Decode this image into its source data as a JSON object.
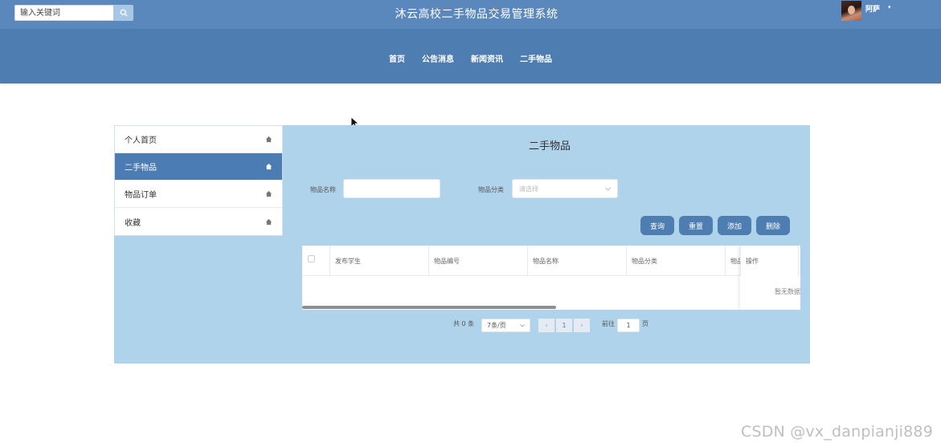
{
  "header": {
    "search_placeholder": "输入关键词",
    "site_title": "沐云高校二手物品交易管理系统",
    "username": "阿萨",
    "caret": "▾"
  },
  "nav": {
    "items": [
      "首页",
      "公告消息",
      "新闻资讯",
      "二手物品"
    ]
  },
  "sidebar": {
    "items": [
      {
        "label": "个人首页",
        "active": false
      },
      {
        "label": "二手物品",
        "active": true
      },
      {
        "label": "物品订单",
        "active": false
      },
      {
        "label": "收藏",
        "active": false
      }
    ]
  },
  "main": {
    "title": "二手物品",
    "filters": {
      "name_label": "物品名称",
      "name_value": "",
      "category_label": "物品分类",
      "category_placeholder": "请选择"
    },
    "buttons": {
      "query": "查询",
      "reset": "重置",
      "add": "添加",
      "delete": "删除"
    },
    "table": {
      "columns": [
        "发布学生",
        "物品编号",
        "物品名称",
        "物品分类",
        "物品"
      ],
      "fixed_column": "操作",
      "empty_text": "暂无数据"
    },
    "pagination": {
      "total": "共 0 条",
      "page_size": "7条/页",
      "current_page": "1",
      "goto_label": "前往",
      "goto_value": "1",
      "page_unit": "页",
      "prev": "‹",
      "next": "›"
    }
  },
  "watermark": "CSDN @vx_danpianji889",
  "colors": {
    "topbar": "#5a88bd",
    "navband": "#4e7db1",
    "panel_bg": "#b0d3ec",
    "accent": "#4b7cb3"
  }
}
